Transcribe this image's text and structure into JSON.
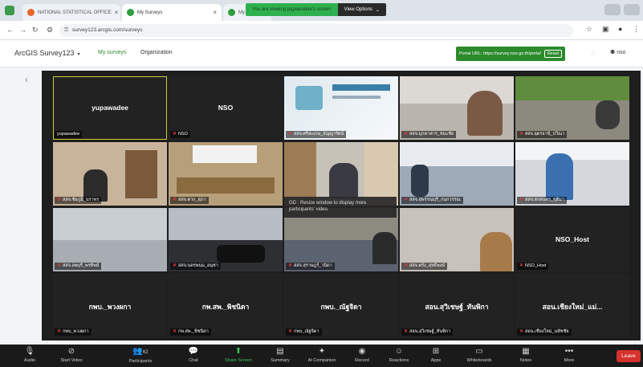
{
  "browser": {
    "tabs": [
      {
        "title": "NATIONAL STATISTICAL OFFICE",
        "active": false
      },
      {
        "title": "My Surveys",
        "active": true
      },
      {
        "title": "My Surveys",
        "active": false
      }
    ],
    "banner_message": "You are viewing pqpawadee's screen",
    "banner_button": "View Options",
    "url": "survey123.arcgis.com/surveys"
  },
  "app": {
    "brand": "ArcGIS Survey123",
    "nav": [
      "My surveys",
      "Organization"
    ],
    "portal_text": "Portal URL: https://survey.nso.go.th/portal",
    "portal_reset": "Reset",
    "user_label": "nso"
  },
  "gallery": {
    "tooltip": "GD : Resize window to display more participants' video.",
    "tiles": [
      {
        "center": "yupawadee",
        "label": "yupawadee",
        "muted": false
      },
      {
        "center": "NSO",
        "label": "NSO",
        "muted": true
      },
      {
        "center": "",
        "label": "สสจ.ศรีสะเกษ_ธัญญารัตน์",
        "muted": true
      },
      {
        "center": "",
        "label": "สสจ.มุกดาหาร_ชนะชัย",
        "muted": true
      },
      {
        "center": "",
        "label": "สสจ.อุดรธานี_ปวีณา",
        "muted": true
      },
      {
        "center": "",
        "label": "สสจ.ชัยภูมิ_นราพร",
        "muted": true
      },
      {
        "center": "",
        "label": "สสจ.ตาก_สุภา",
        "muted": true
      },
      {
        "center": "",
        "label": "",
        "muted": false
      },
      {
        "center": "",
        "label": "สสจ.สุพรรณบุรี_กนกวรรณ",
        "muted": true
      },
      {
        "center": "",
        "label": "สสจ.สกลนคร_ชุติมา",
        "muted": true
      },
      {
        "center": "",
        "label": "สสจ.ลพบุรี_พรทิพย์",
        "muted": true
      },
      {
        "center": "",
        "label": "สสจ.นครพนม_อนุชา",
        "muted": true
      },
      {
        "center": "",
        "label": "สสจ.สุราษฎร์_วนิดา",
        "muted": true
      },
      {
        "center": "",
        "label": "สสจ.ตรัง_สุทธิพงษ์",
        "muted": true
      },
      {
        "center": "NSO_Host",
        "label": "NSO_Host",
        "muted": true
      },
      {
        "center": "กพบ._พวงผกา",
        "label": "กพบ_พวงผกา",
        "muted": true
      },
      {
        "center": "กพ.สพ._พิชนิดา",
        "label": "กพ.สพ._พิชนิดา",
        "muted": true
      },
      {
        "center": "กพบ._ณัฐจิดา",
        "label": "กพบ_ณัฐจิดา",
        "muted": true
      },
      {
        "center": "สอน.สุวิเชษฐ์_ทันพิกา",
        "label": "สอน.สุวิเชษฐ์_ทันพิกา",
        "muted": true
      },
      {
        "center": "สอน.เชียงใหม่_แม่...",
        "label": "สอน.เชียงใหม่_นพัชชัย",
        "muted": true
      }
    ]
  },
  "toolbar": {
    "audio": "Audio",
    "start_video": "Start Video",
    "participants": "Participants",
    "participants_count": "62",
    "chat": "Chat",
    "share_screen": "Share Screen",
    "summary": "Summary",
    "ai_companion": "AI Companion",
    "record": "Record",
    "reactions": "Reactions",
    "apps": "Apps",
    "whiteboards": "Whiteboards",
    "notes": "Notes",
    "more": "More",
    "leave": "Leave"
  },
  "colors": {
    "brand_green": "#2c8a2c",
    "zoom_green": "#2fb04f",
    "leave_red": "#d6322d",
    "active_speaker": "#c9cc3a"
  }
}
